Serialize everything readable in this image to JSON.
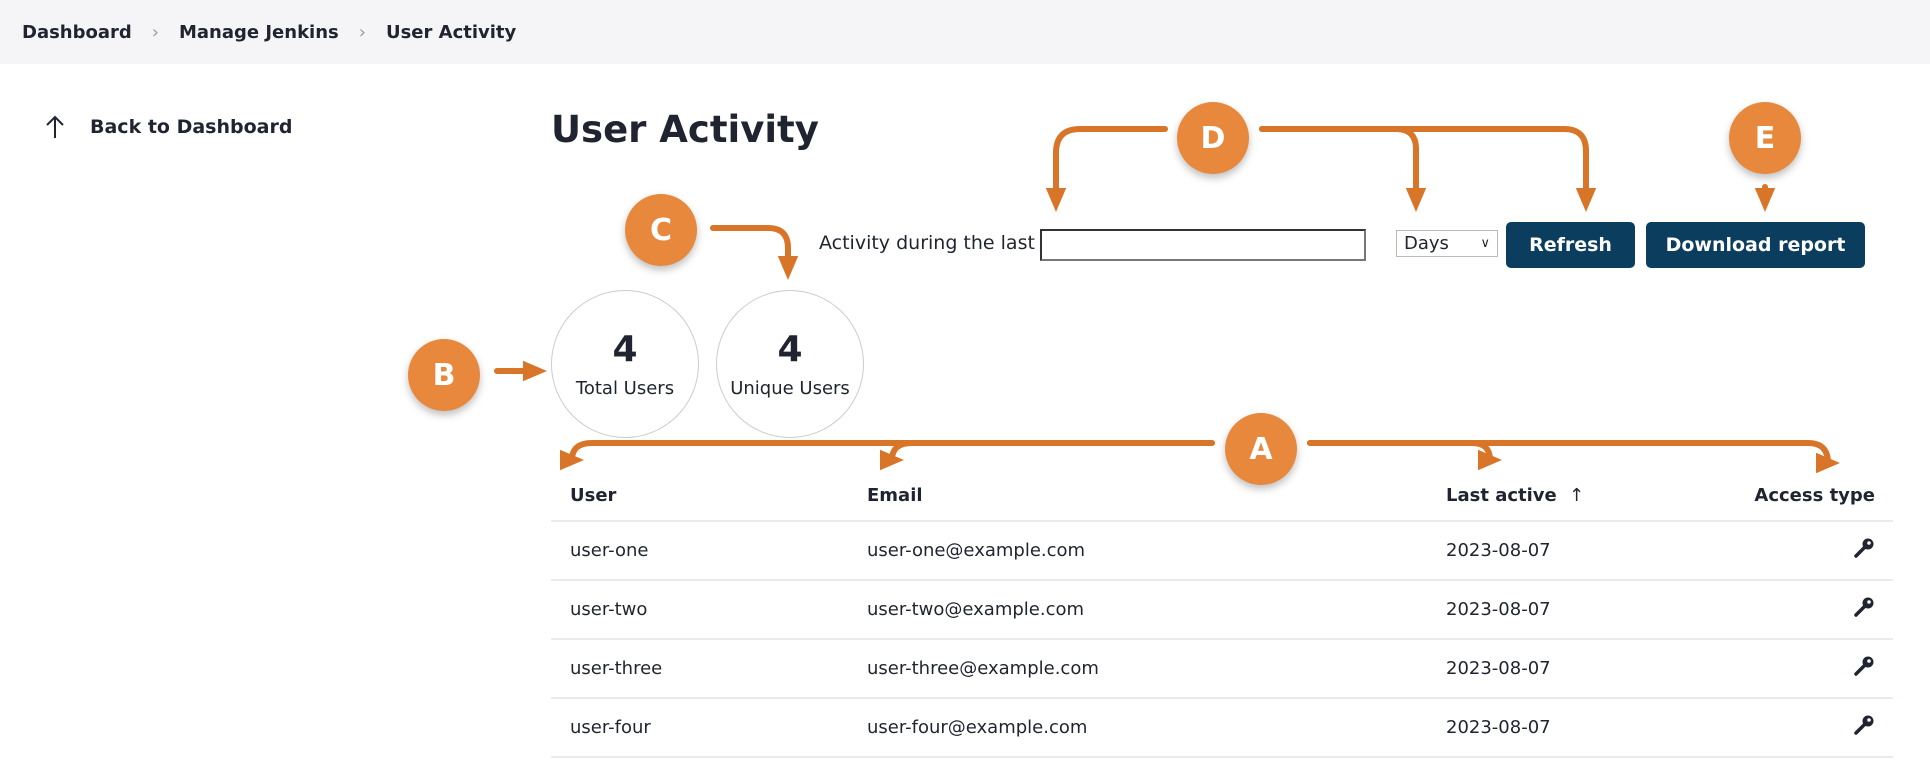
{
  "breadcrumb": [
    "Dashboard",
    "Manage Jenkins",
    "User Activity"
  ],
  "sidebar": {
    "back_label": "Back to Dashboard",
    "icon": "arrow-up-icon"
  },
  "page": {
    "title": "User Activity"
  },
  "filter": {
    "label": "Activity during the last",
    "input_value": "",
    "unit_selected": "Days",
    "refresh_label": "Refresh",
    "download_label": "Download report"
  },
  "stats": [
    {
      "value": "4",
      "label": "Total Users"
    },
    {
      "value": "4",
      "label": "Unique Users"
    }
  ],
  "table": {
    "columns": [
      "User",
      "Email",
      "Last active",
      "Access type"
    ],
    "sort_indicator": "↑",
    "rows": [
      {
        "user": "user-one",
        "email": "user-one@example.com",
        "last_active": "2023-08-07",
        "access": "key-icon"
      },
      {
        "user": "user-two",
        "email": "user-two@example.com",
        "last_active": "2023-08-07",
        "access": "key-icon"
      },
      {
        "user": "user-three",
        "email": "user-three@example.com",
        "last_active": "2023-08-07",
        "access": "key-icon"
      },
      {
        "user": "user-four",
        "email": "user-four@example.com",
        "last_active": "2023-08-07",
        "access": "key-icon"
      }
    ]
  },
  "annotations": [
    "A",
    "B",
    "C",
    "D",
    "E"
  ],
  "colors": {
    "accent": "#0b3d5e",
    "annotation": "#e8883c",
    "annotation_line": "#d97528",
    "topbar": "#f5f5f7"
  }
}
